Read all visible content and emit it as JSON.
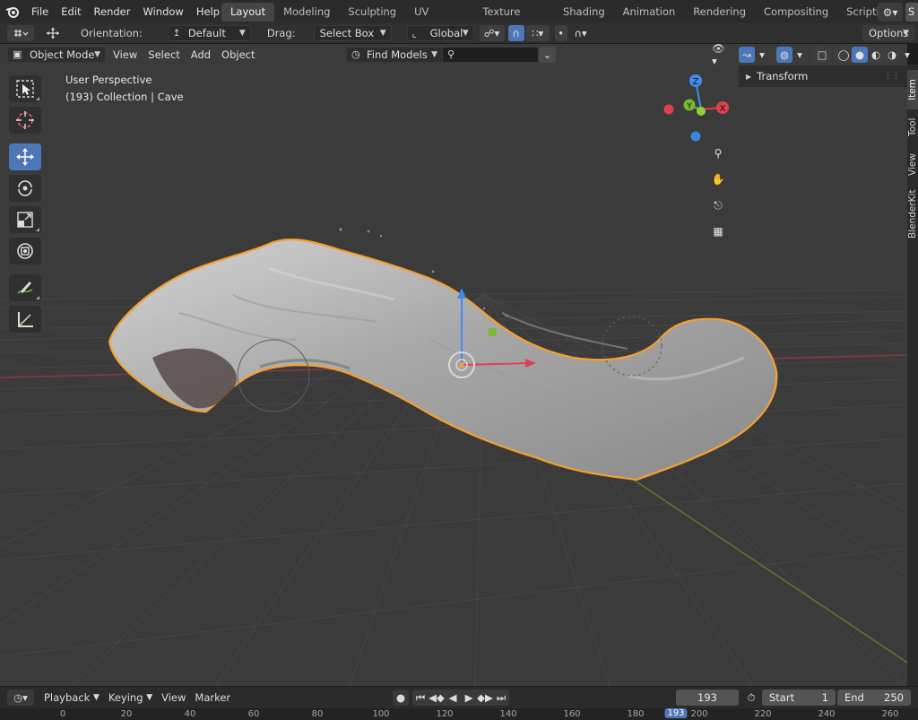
{
  "menu": [
    "File",
    "Edit",
    "Render",
    "Window",
    "Help"
  ],
  "workspaces": [
    "Layout",
    "Modeling",
    "Sculpting",
    "UV Editing",
    "Texture Paint",
    "Shading",
    "Animation",
    "Rendering",
    "Compositing",
    "Scripting"
  ],
  "active_workspace": "Layout",
  "scene_label": "S",
  "tool_header": {
    "orientation_label": "Orientation:",
    "orientation_value": "Default",
    "drag_label": "Drag:",
    "drag_value": "Select Box",
    "transform_space": "Global",
    "options_label": "Options"
  },
  "viewport_header": {
    "mode": "Object Mode",
    "menus": [
      "View",
      "Select",
      "Add",
      "Object"
    ],
    "find_models": "Find Models",
    "search_value": ""
  },
  "viewport": {
    "perspective": "User Perspective",
    "collection_info": "(193) Collection | Cave",
    "object_name": "Cave"
  },
  "gizmo": {
    "z": "Z",
    "y": "Y",
    "x": "X"
  },
  "npanel": {
    "section": "Transform"
  },
  "side_tabs": [
    "Item",
    "Tool",
    "View",
    "BlenderKit"
  ],
  "timeline": {
    "menus": [
      "Playback",
      "Keying",
      "View",
      "Marker"
    ],
    "current_frame": "193",
    "start_label": "Start",
    "start_value": "1",
    "end_label": "End",
    "end_value": "250"
  },
  "ruler": [
    "0",
    "20",
    "40",
    "60",
    "80",
    "100",
    "120",
    "140",
    "160",
    "180",
    "200",
    "220",
    "240",
    "260"
  ],
  "ruler_current": "193",
  "colors": {
    "accent": "#4d77b8",
    "selection": "#f5a030",
    "x_axis": "#e0404f",
    "y_axis": "#78b82e",
    "z_axis": "#3d8ef0"
  }
}
